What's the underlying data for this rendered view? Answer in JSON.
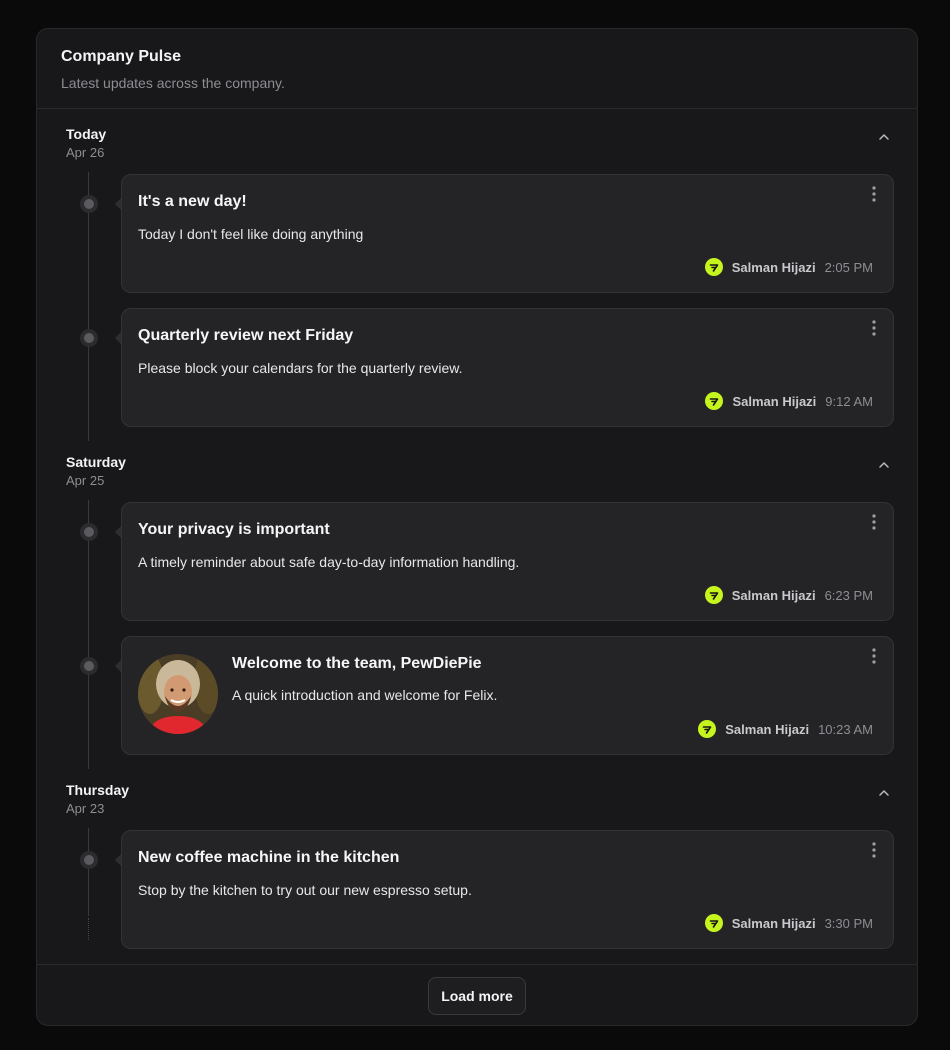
{
  "header": {
    "title": "Company Pulse",
    "subtitle": "Latest updates across the company."
  },
  "groups": [
    {
      "day": "Today",
      "date": "Apr 26",
      "posts": [
        {
          "title": "It's a new day!",
          "body": "Today I don't feel like doing anything",
          "author": "Salman Hijazi",
          "time": "2:05 PM"
        },
        {
          "title": "Quarterly review next Friday",
          "body": "Please block your calendars for the quarterly review.",
          "author": "Salman Hijazi",
          "time": "9:12 AM"
        }
      ]
    },
    {
      "day": "Saturday",
      "date": "Apr 25",
      "posts": [
        {
          "title": "Your privacy is important",
          "body": "A timely reminder about safe day-to-day information handling.",
          "author": "Salman Hijazi",
          "time": "6:23 PM"
        },
        {
          "title": "Welcome to the team, PewDiePie",
          "body": "A quick introduction and welcome for Felix.",
          "author": "Salman Hijazi",
          "time": "10:23 AM"
        }
      ]
    },
    {
      "day": "Thursday",
      "date": "Apr 23",
      "posts": [
        {
          "title": "New coffee machine in the kitchen",
          "body": "Stop by the kitchen to try out our new espresso setup.",
          "author": "Salman Hijazi",
          "time": "3:30 PM"
        }
      ]
    }
  ],
  "footer": {
    "load_more_label": "Load more"
  },
  "icons": {
    "collapse": "chevron-up-icon",
    "more": "more-vertical-icon",
    "author_badge": "brand-logo-icon"
  },
  "colors": {
    "accent": "#c6f51d",
    "background": "#0a0a0b",
    "panel": "#18181a",
    "card": "#242427"
  }
}
